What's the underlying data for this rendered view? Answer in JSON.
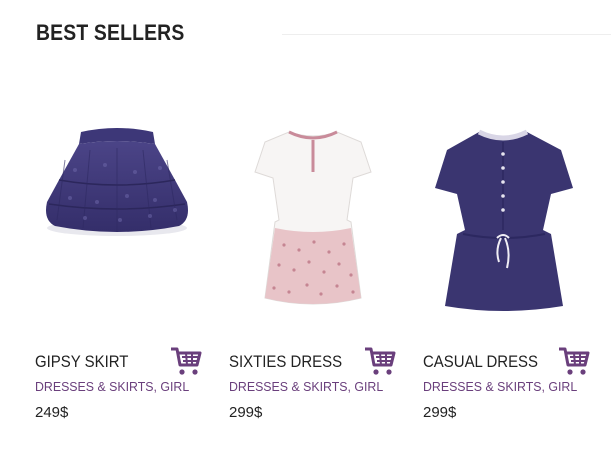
{
  "section": {
    "title": "BEST SELLERS"
  },
  "colors": {
    "accent": "#6a3f7c",
    "text": "#222222",
    "navy": "#3a3570"
  },
  "products": [
    {
      "name": "GIPSY SKIRT",
      "category": "DRESSES & SKIRTS, GIRL",
      "price": "249$",
      "cart_icon": "shopping-cart-icon"
    },
    {
      "name": "SIXTIES DRESS",
      "category": "DRESSES & SKIRTS, GIRL",
      "price": "299$",
      "cart_icon": "shopping-cart-icon"
    },
    {
      "name": "CASUAL DRESS",
      "category": "DRESSES & SKIRTS, GIRL",
      "price": "299$",
      "cart_icon": "shopping-cart-icon"
    }
  ]
}
